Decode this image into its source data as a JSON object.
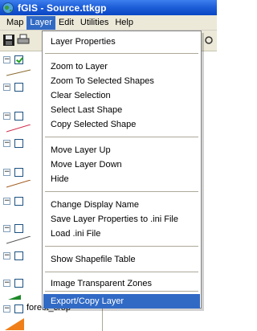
{
  "window": {
    "title": "fGIS - Source.ttkgp",
    "icon": "globe-icon"
  },
  "menubar": {
    "items": [
      {
        "label": "Map",
        "active": false
      },
      {
        "label": "Layer",
        "active": true
      },
      {
        "label": "Edit",
        "active": false
      },
      {
        "label": "Utilities",
        "active": false
      },
      {
        "label": "Help",
        "active": false
      }
    ]
  },
  "layer_menu": {
    "items": [
      {
        "label": "Layer Properties"
      },
      {
        "label": "Zoom to Layer"
      },
      {
        "label": "Zoom To Selected Shapes"
      },
      {
        "label": "Clear Selection"
      },
      {
        "label": "Select Last Shape"
      },
      {
        "label": "Copy Selected Shape"
      },
      {
        "label": "Move Layer Up"
      },
      {
        "label": "Move Layer Down"
      },
      {
        "label": "Hide"
      },
      {
        "label": "Change Display Name"
      },
      {
        "label": "Save Layer Properties to .ini File"
      },
      {
        "label": "Load .ini File"
      },
      {
        "label": "Show Shapefile Table"
      },
      {
        "label": "Image Transparent Zones"
      },
      {
        "label": "Export/Copy Layer",
        "highlighted": true
      }
    ]
  },
  "layers_panel": {
    "visible_layer_label": "forest_crop",
    "tree_expander_glyph": "−"
  },
  "colors": {
    "titlebar": "#0a46c4",
    "menu_highlight": "#316ac5",
    "chrome": "#ece9d8"
  }
}
